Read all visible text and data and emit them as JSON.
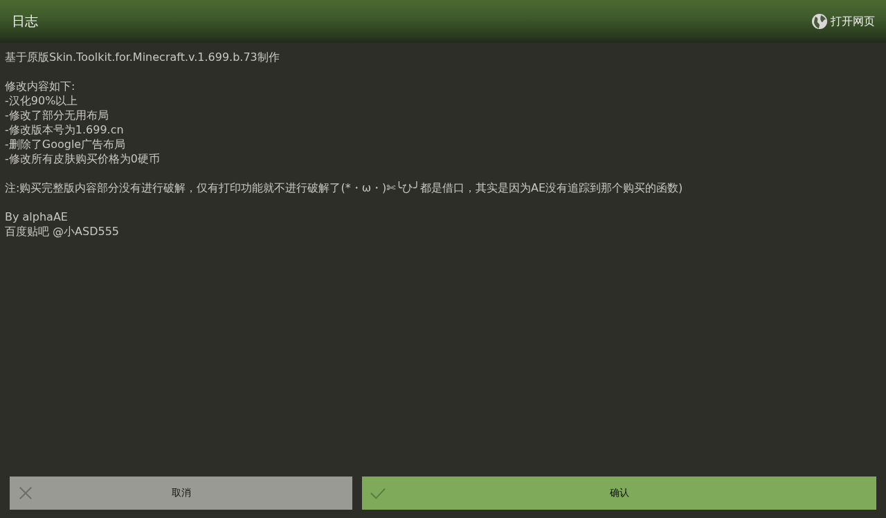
{
  "header": {
    "title": "日志",
    "action": {
      "label": "打开网页"
    }
  },
  "log": {
    "paragraphs": [
      [
        "基于原版Skin.Toolkit.for.Minecraft.v.1.699.b.73制作"
      ],
      [
        "修改内容如下:",
        "-汉化90%以上",
        "-修改了部分无用布局",
        "-修改版本号为1.699.cn",
        "-删除了Google广告布局",
        "-修改所有皮肤购买价格为0硬币"
      ],
      [
        "注:购买完整版内容部分没有进行破解，仅有打印功能就不进行破解了(*・ω・)✄╰ひ╯都是借口，其实是因为AE没有追踪到那个购买的函数)"
      ],
      [
        "By alphaAE",
        "百度贴吧 @小ASD555"
      ]
    ]
  },
  "buttons": [
    {
      "kind": "cancel",
      "label": "取消"
    },
    {
      "kind": "confirm",
      "label": "确认"
    }
  ]
}
